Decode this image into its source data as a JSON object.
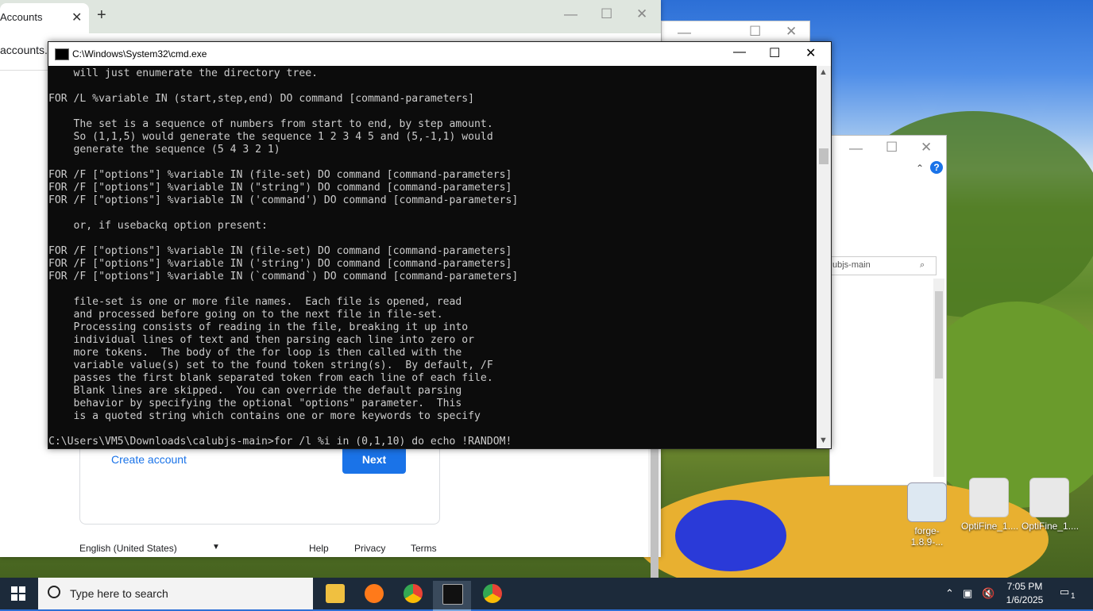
{
  "browser": {
    "tab_title": "Accounts",
    "tab_close": "✕",
    "new_tab": "+",
    "minimize": "—",
    "maximize": "☐",
    "close": "✕",
    "url": "accounts.g",
    "create_account": "Create account",
    "next": "Next",
    "language": "English (United States)",
    "help": "Help",
    "privacy": "Privacy",
    "terms": "Terms"
  },
  "explorer": {
    "search_text": "ubjs-main"
  },
  "cmd": {
    "title": "C:\\Windows\\System32\\cmd.exe",
    "lines": [
      "    will just enumerate the directory tree.",
      "",
      "FOR /L %variable IN (start,step,end) DO command [command-parameters]",
      "",
      "    The set is a sequence of numbers from start to end, by step amount.",
      "    So (1,1,5) would generate the sequence 1 2 3 4 5 and (5,-1,1) would",
      "    generate the sequence (5 4 3 2 1)",
      "",
      "FOR /F [\"options\"] %variable IN (file-set) DO command [command-parameters]",
      "FOR /F [\"options\"] %variable IN (\"string\") DO command [command-parameters]",
      "FOR /F [\"options\"] %variable IN ('command') DO command [command-parameters]",
      "",
      "    or, if usebackq option present:",
      "",
      "FOR /F [\"options\"] %variable IN (file-set) DO command [command-parameters]",
      "FOR /F [\"options\"] %variable IN ('string') DO command [command-parameters]",
      "FOR /F [\"options\"] %variable IN (`command`) DO command [command-parameters]",
      "",
      "    file-set is one or more file names.  Each file is opened, read",
      "    and processed before going on to the next file in file-set.",
      "    Processing consists of reading in the file, breaking it up into",
      "    individual lines of text and then parsing each line into zero or",
      "    more tokens.  The body of the for loop is then called with the",
      "    variable value(s) set to the found token string(s).  By default, /F",
      "    passes the first blank separated token from each line of each file.",
      "    Blank lines are skipped.  You can override the default parsing",
      "    behavior by specifying the optional \"options\" parameter.  This",
      "    is a quoted string which contains one or more keywords to specify",
      "",
      "C:\\Users\\VM5\\Downloads\\calubjs-main>for /l %i in (0,1,10) do echo !RANDOM!"
    ]
  },
  "desktop_icons": [
    "forge-1.8.9-...",
    "OptiFine_1....",
    "OptiFine_1...."
  ],
  "taskbar": {
    "search_placeholder": "Type here to search",
    "time": "7:05 PM",
    "date": "1/6/2025",
    "notification_count": "1"
  }
}
